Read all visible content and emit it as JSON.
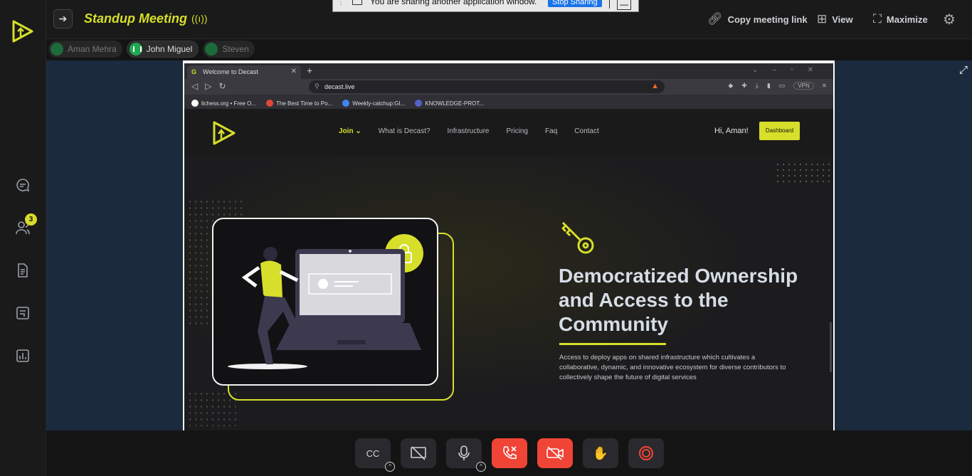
{
  "meeting": {
    "title": "Standup Meeting",
    "live_icon": "((ı))"
  },
  "share_banner": {
    "message": "You are sharing another application window.",
    "stop_label": "Stop Sharing",
    "minimize_label": "—"
  },
  "topbar_actions": [
    {
      "icon": "link-icon",
      "label": "Copy meeting link"
    },
    {
      "icon": "grid-icon",
      "label": "View"
    },
    {
      "icon": "maximize-icon",
      "label": "Maximize"
    }
  ],
  "rail": {
    "participants_badge": "3"
  },
  "participants": [
    {
      "name": "Aman Mehra",
      "active": false
    },
    {
      "name": "John Miguel",
      "active": true
    },
    {
      "name": "Steven",
      "active": false
    }
  ],
  "browser": {
    "tab_title": "Welcome to Decast",
    "tab_favicon": "G",
    "url": "decast.live",
    "vpn_label": "VPN",
    "bookmarks": [
      {
        "label": "lichess.org • Free O...",
        "color": "#ffffff"
      },
      {
        "label": "The Best Time to Po...",
        "color": "#e0463b"
      },
      {
        "label": "Weekly-catchup:GI...",
        "color": "#4285f4"
      },
      {
        "label": "KNOWLEDGE-PROT...",
        "color": "#5561c9"
      }
    ]
  },
  "site": {
    "nav": {
      "join": "Join",
      "items": [
        "What is Decast?",
        "Infrastructure",
        "Pricing",
        "Faq",
        "Contact"
      ]
    },
    "greeting": "Hi, Aman!",
    "dashboard_label": "Dashboard",
    "headline": "Democratized Ownership and Access to the Community",
    "description": "Access to deploy apps on shared infrastructure which cultivates a collaborative, dynamic, and innovative ecosystem for diverse contributors to collectively shape the future of digital services"
  },
  "controls": [
    {
      "name": "captions-button",
      "glyph": "CC",
      "red": false,
      "chevron": true
    },
    {
      "name": "screen-share-off-button",
      "glyph": "⧄",
      "red": false,
      "chevron": false
    },
    {
      "name": "microphone-button",
      "glyph": "🎙",
      "red": false,
      "chevron": true
    },
    {
      "name": "end-call-button",
      "glyph": "✆",
      "red": true,
      "chevron": false
    },
    {
      "name": "camera-off-button",
      "glyph": "▶",
      "red": true,
      "chevron": false
    },
    {
      "name": "raise-hand-button",
      "glyph": "✋",
      "red": false,
      "chevron": false
    },
    {
      "name": "record-button",
      "glyph": "◉",
      "red": false,
      "chevron": false
    }
  ],
  "colors": {
    "accent": "#d7df2a",
    "danger": "#f04436",
    "stage_bg": "#1b2a3d"
  }
}
